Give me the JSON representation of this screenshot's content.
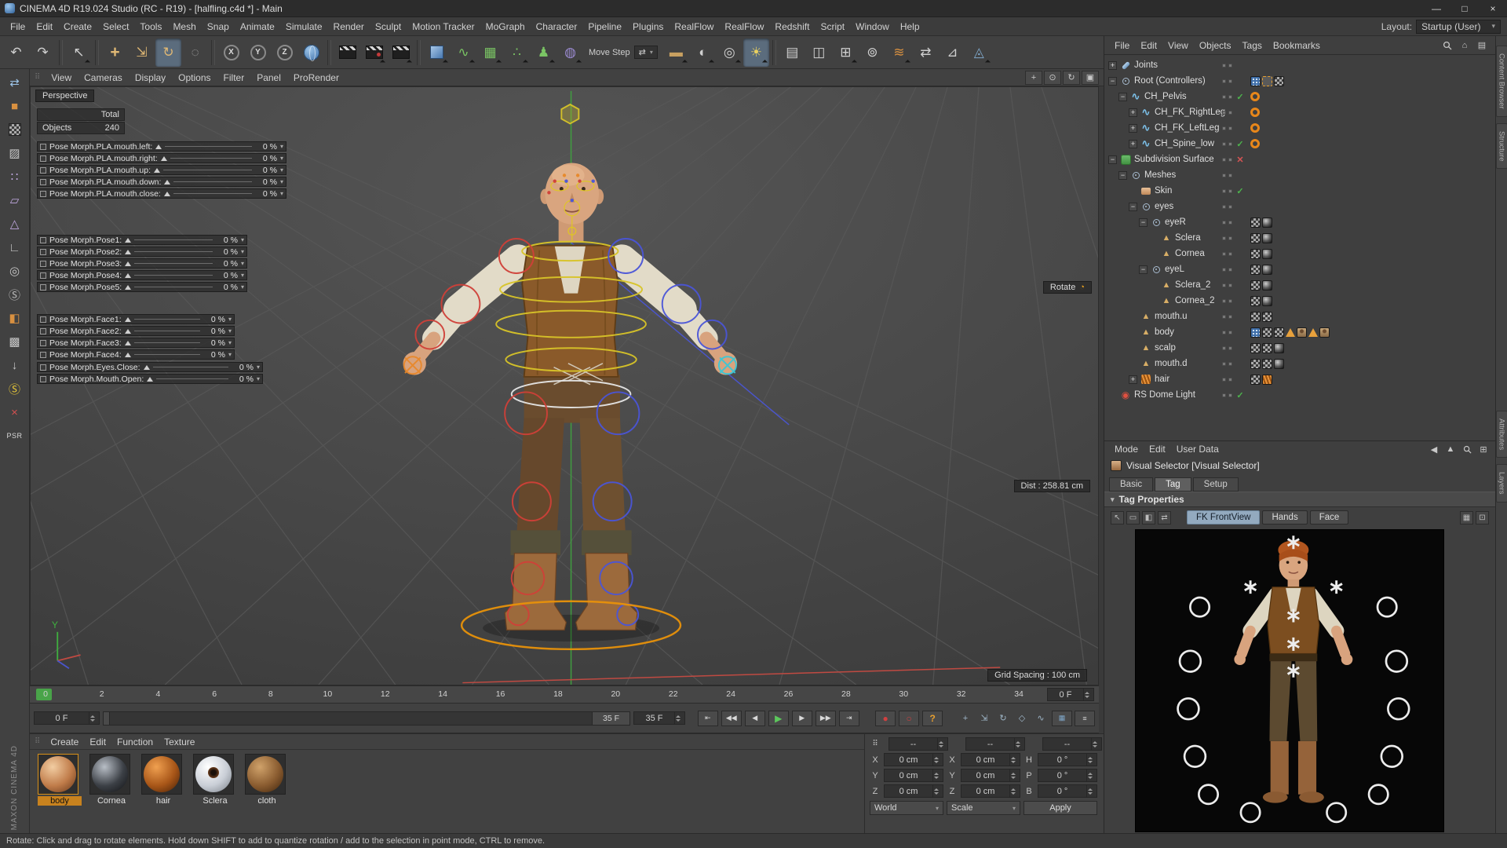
{
  "window": {
    "title": "CINEMA 4D R19.024 Studio (RC - R19) - [halfling.c4d *] - Main",
    "controls": {
      "minimize": "—",
      "maximize": "□",
      "close": "×"
    }
  },
  "menubar": {
    "items": [
      "File",
      "Edit",
      "Create",
      "Select",
      "Tools",
      "Mesh",
      "Snap",
      "Animate",
      "Simulate",
      "Render",
      "Sculpt",
      "Motion Tracker",
      "MoGraph",
      "Character",
      "Pipeline",
      "Plugins",
      "RealFlow",
      "RealFlow",
      "Redshift",
      "Script",
      "Window",
      "Help"
    ],
    "layout_label": "Layout:",
    "layout_value": "Startup (User)"
  },
  "toolbar": {
    "move_step_label": "Move Step",
    "axis_buttons": [
      "X",
      "Y",
      "Z"
    ],
    "icon_names": [
      "undo-icon",
      "redo-icon",
      "live-selection-icon",
      "move-tool-icon",
      "scale-tool-icon",
      "rotate-tool-icon",
      "last-tool-icon",
      "x-axis-lock",
      "y-axis-lock",
      "z-axis-lock",
      "coordinate-system-icon",
      "render-view-icon",
      "render-picture-viewer-icon",
      "render-settings-icon",
      "add-cube-icon",
      "add-spline-icon",
      "add-generator-icon",
      "add-mograph-icon",
      "add-character-icon",
      "add-deformer-icon",
      "add-floor-icon",
      "add-environment-icon",
      "add-camera-icon",
      "add-light-icon",
      "workplane-icon",
      "view-settings-icon",
      "snap-settings-icon",
      "measure-icon",
      "hair-tools-icon",
      "exchange-icon",
      "knife-icon",
      "volume-icon"
    ]
  },
  "left_toolbar": {
    "psr_label": "PSR",
    "icon_names": [
      "make-editable-icon",
      "model-mode-icon",
      "texture-mode-icon",
      "workplane-mode-icon",
      "points-mode-icon",
      "edges-mode-icon",
      "polygons-mode-icon",
      "axis-mode-icon",
      "solo-mode-icon",
      "snap-mode-icon",
      "paint-mode-icon",
      "lock-workplane-icon",
      "enable-axis-icon",
      "quantize-icon",
      "delete-icon"
    ]
  },
  "viewport": {
    "menu": [
      "View",
      "Cameras",
      "Display",
      "Options",
      "Filter",
      "Panel",
      "ProRender"
    ],
    "camera_label": "Perspective",
    "hud": {
      "total_label": "Total",
      "objects_label": "Objects",
      "objects_value": "240",
      "rotate_label": "Rotate",
      "dist_label": "Dist : 258.81 cm",
      "grid_label": "Grid Spacing : 100 cm",
      "axis_y_label": "Y"
    },
    "sliders_mouth": [
      {
        "label": "Pose Morph.PLA.mouth.left:",
        "value": "0 %"
      },
      {
        "label": "Pose Morph.PLA.mouth.right:",
        "value": "0 %"
      },
      {
        "label": "Pose Morph.PLA.mouth.up:",
        "value": "0 %"
      },
      {
        "label": "Pose Morph.PLA.mouth.down:",
        "value": "0 %"
      },
      {
        "label": "Pose Morph.PLA.mouth.close:",
        "value": "0 %"
      }
    ],
    "sliders_pose": [
      {
        "label": "Pose Morph.Pose1:",
        "value": "0 %"
      },
      {
        "label": "Pose Morph.Pose2:",
        "value": "0 %"
      },
      {
        "label": "Pose Morph.Pose3:",
        "value": "0 %"
      },
      {
        "label": "Pose Morph.Pose4:",
        "value": "0 %"
      },
      {
        "label": "Pose Morph.Pose5:",
        "value": "0 %"
      }
    ],
    "sliders_face": [
      {
        "label": "Pose Morph.Face1:",
        "value": "0 %"
      },
      {
        "label": "Pose Morph.Face2:",
        "value": "0 %"
      },
      {
        "label": "Pose Morph.Face3:",
        "value": "0 %"
      },
      {
        "label": "Pose Morph.Face4:",
        "value": "0 %"
      }
    ],
    "sliders_misc": [
      {
        "label": "Pose Morph.Eyes.Close:",
        "value": "0 %"
      },
      {
        "label": "Pose Morph.Mouth.Open:",
        "value": "0 %"
      }
    ]
  },
  "timeline": {
    "ticks": [
      "0",
      "2",
      "4",
      "6",
      "8",
      "10",
      "12",
      "14",
      "16",
      "18",
      "20",
      "22",
      "24",
      "26",
      "28",
      "30",
      "32",
      "34"
    ],
    "frame_spinner": "0 F"
  },
  "transport": {
    "current_frame": "0 F",
    "range_end_handle": "35 F",
    "end_frame": "35 F",
    "button_names": [
      "goto-start",
      "previous-key",
      "previous-frame",
      "play",
      "next-frame",
      "next-key",
      "goto-end",
      "record-keyframe",
      "autokey",
      "help",
      "record-position",
      "record-scale",
      "record-rotation",
      "record-parameter",
      "record-pla"
    ]
  },
  "materials": {
    "menu": [
      "Create",
      "Edit",
      "Function",
      "Texture"
    ],
    "items": [
      {
        "name": "body",
        "selected": true
      },
      {
        "name": "Cornea",
        "selected": false
      },
      {
        "name": "hair",
        "selected": false
      },
      {
        "name": "Sclera",
        "selected": false
      },
      {
        "name": "cloth",
        "selected": false
      }
    ]
  },
  "coordinates": {
    "header": [
      "--",
      "--",
      "--"
    ],
    "rows": [
      {
        "l1": "X",
        "v1": "0 cm",
        "l2": "X",
        "v2": "0 cm",
        "l3": "H",
        "v3": "0 °"
      },
      {
        "l1": "Y",
        "v1": "0 cm",
        "l2": "Y",
        "v2": "0 cm",
        "l3": "P",
        "v3": "0 °"
      },
      {
        "l1": "Z",
        "v1": "0 cm",
        "l2": "Z",
        "v2": "0 cm",
        "l3": "B",
        "v3": "0 °"
      }
    ],
    "mode": "World",
    "scale": "Scale",
    "apply": "Apply"
  },
  "object_manager": {
    "menu": [
      "File",
      "Edit",
      "View",
      "Objects",
      "Tags",
      "Bookmarks"
    ],
    "items": [
      {
        "label": "Joints",
        "icon": "joint-icon"
      },
      {
        "label": "Root (Controllers)",
        "icon": "null-icon"
      },
      {
        "label": "CH_Pelvis",
        "icon": "controller-icon"
      },
      {
        "label": "CH_FK_RightLeg",
        "icon": "controller-icon"
      },
      {
        "label": "CH_FK_LeftLeg",
        "icon": "controller-icon"
      },
      {
        "label": "CH_Spine_low",
        "icon": "controller-icon"
      },
      {
        "label": "Subdivision Surface",
        "icon": "sds-icon"
      },
      {
        "label": "Meshes",
        "icon": "null-icon"
      },
      {
        "label": "Skin",
        "icon": "skin-icon"
      },
      {
        "label": "eyes",
        "icon": "null-icon"
      },
      {
        "label": "eyeR",
        "icon": "null-icon"
      },
      {
        "label": "Sclera",
        "icon": "polygon-icon"
      },
      {
        "label": "Cornea",
        "icon": "polygon-icon"
      },
      {
        "label": "eyeL",
        "icon": "null-icon"
      },
      {
        "label": "Sclera_2",
        "icon": "polygon-icon"
      },
      {
        "label": "Cornea_2",
        "icon": "polygon-icon"
      },
      {
        "label": "mouth.u",
        "icon": "polygon-icon"
      },
      {
        "label": "body",
        "icon": "polygon-icon"
      },
      {
        "label": "scalp",
        "icon": "polygon-icon"
      },
      {
        "label": "mouth.d",
        "icon": "polygon-icon"
      },
      {
        "label": "hair",
        "icon": "hair-icon"
      },
      {
        "label": "RS Dome Light",
        "icon": "light-icon"
      }
    ]
  },
  "attribute_manager": {
    "menu": [
      "Mode",
      "Edit",
      "User Data"
    ],
    "title": "Visual Selector [Visual Selector]",
    "tabs": [
      "Basic",
      "Tag",
      "Setup"
    ],
    "active_tab": "Tag",
    "section": "Tag Properties",
    "buttons": [
      "FK FrontView",
      "Hands",
      "Face"
    ],
    "active_button": "FK FrontView"
  },
  "right_edge": {
    "tabs": [
      "Content Browser",
      "Structure",
      "Attributes",
      "Layers"
    ]
  },
  "statusbar": {
    "text": "Rotate: Click and drag to rotate elements. Hold down SHIFT to add to quantize rotation / add to the selection in point mode, CTRL to remove."
  },
  "brand": {
    "text": "MAXON CINEMA 4D"
  }
}
